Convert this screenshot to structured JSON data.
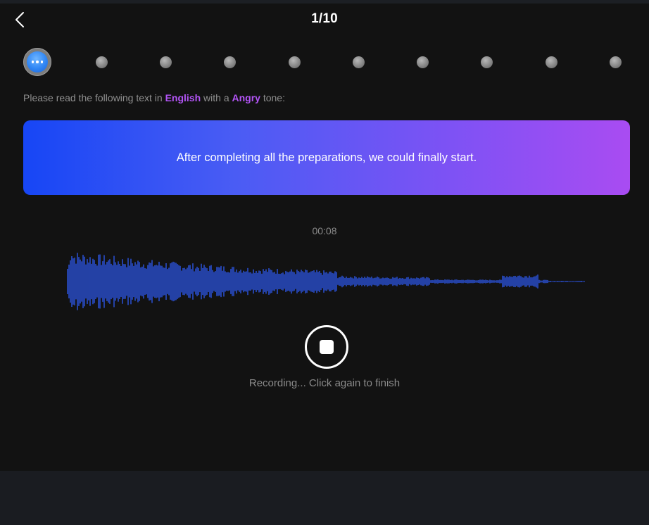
{
  "header": {
    "back_icon": "chevron-left-icon",
    "page_counter": "1/10"
  },
  "progress": {
    "current_step": 1,
    "total_steps": 10,
    "current_icon": "more-dots-icon"
  },
  "instruction": {
    "prefix": "Please read the following text in ",
    "language": "English",
    "middle": " with a ",
    "tone": "Angry",
    "suffix": " tone:"
  },
  "prompt": {
    "text": "After completing all the preparations, we could finally start."
  },
  "recorder": {
    "elapsed": "00:08",
    "stop_icon": "stop-icon",
    "status": "Recording... Click again to finish"
  },
  "colors": {
    "accent": "#b254f5",
    "waveform": "#2f5bf5",
    "gradient_start": "#1746f5",
    "gradient_end": "#a94cf2"
  }
}
